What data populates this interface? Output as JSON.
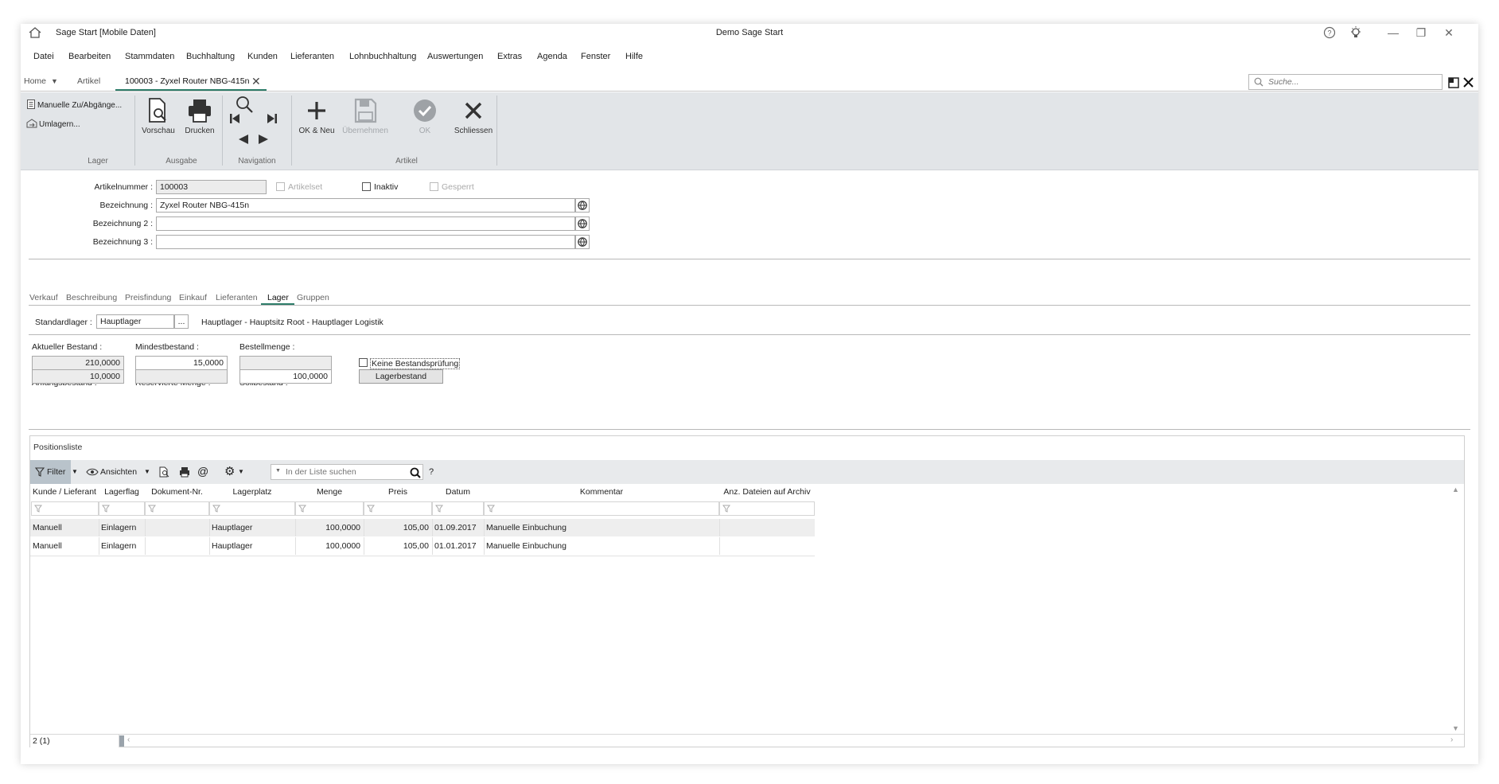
{
  "titlebar": {
    "app_title": "Sage Start [Mobile Daten]",
    "center_title": "Demo Sage Start",
    "minimize": "—",
    "maximize": "❐",
    "close": "✕"
  },
  "menu": [
    "Datei",
    "Bearbeiten",
    "Stammdaten",
    "Buchhaltung",
    "Kunden",
    "Lieferanten",
    "Lohnbuchhaltung",
    "Auswertungen",
    "Extras",
    "Agenda",
    "Fenster",
    "Hilfe"
  ],
  "tabs": {
    "home": "Home",
    "artikel": "Artikel",
    "current": "100003 - Zyxel Router NBG-415n"
  },
  "search": {
    "placeholder": "Suche..."
  },
  "ribbon": {
    "lager_items": [
      "Manuelle Zu/Abgänge...",
      "Umlagern..."
    ],
    "vorschau": "Vorschau",
    "drucken": "Drucken",
    "ok_neu": "OK & Neu",
    "uebernehmen": "Übernehmen",
    "ok": "OK",
    "schliessen": "Schliessen",
    "groups": [
      "Lager",
      "Ausgabe",
      "Navigation",
      "Artikel"
    ]
  },
  "header_form": {
    "artikelnummer_label": "Artikelnummer :",
    "artikelnummer": "100003",
    "artikelset": "Artikelset",
    "inaktiv": "Inaktiv",
    "gesperrt": "Gesperrt",
    "bezeichnung_label": "Bezeichnung :",
    "bezeichnung": "Zyxel Router NBG-415n",
    "bezeichnung2_label": "Bezeichnung 2 :",
    "bezeichnung2": "",
    "bezeichnung3_label": "Bezeichnung 3 :",
    "bezeichnung3": ""
  },
  "subtabs": [
    "Verkauf",
    "Beschreibung",
    "Preisfindung",
    "Einkauf",
    "Lieferanten",
    "Lager",
    "Gruppen"
  ],
  "lager": {
    "standardlager_label": "Standardlager :",
    "standardlager": "Hauptlager",
    "browse": "...",
    "standardlager_desc": "Hauptlager - Hauptsitz Root - Hauptlager Logistik",
    "aktueller_bestand_label": "Aktueller Bestand :",
    "aktueller_bestand": "210,0000",
    "mindestbestand_label": "Mindestbestand :",
    "mindestbestand": "15,0000",
    "bestellmenge_label": "Bestellmenge :",
    "bestellmenge": "",
    "keine_bestandspruefung": "Keine Bestandsprüfung",
    "anfangsbestand_label": "Anfangsbestand :",
    "anfangsbestand": "10,0000",
    "reservierte_menge_label": "Reservierte Menge :",
    "reservierte_menge": "",
    "sollbestand_label": "Sollbestand :",
    "sollbestand": "100,0000",
    "lagerbestand_button": "Lagerbestand"
  },
  "positionsliste": {
    "title": "Positionsliste",
    "filter": "Filter",
    "ansichten": "Ansichten",
    "search_placeholder": "In der Liste suchen",
    "help": "?",
    "columns": [
      "Kunde / Lieferant",
      "Lagerflag",
      "Dokument-Nr.",
      "Lagerplatz",
      "Menge",
      "Preis",
      "Datum",
      "Kommentar",
      "Anz. Dateien auf Archiv"
    ],
    "rows": [
      [
        "Manuell",
        "Einlagern",
        "",
        "Hauptlager",
        "100,0000",
        "105,00",
        "01.09.2017",
        "Manuelle Einbuchung",
        ""
      ],
      [
        "Manuell",
        "Einlagern",
        "",
        "Hauptlager",
        "100,0000",
        "105,00",
        "01.01.2017",
        "Manuelle Einbuchung",
        ""
      ]
    ],
    "count": "2 (1)"
  }
}
